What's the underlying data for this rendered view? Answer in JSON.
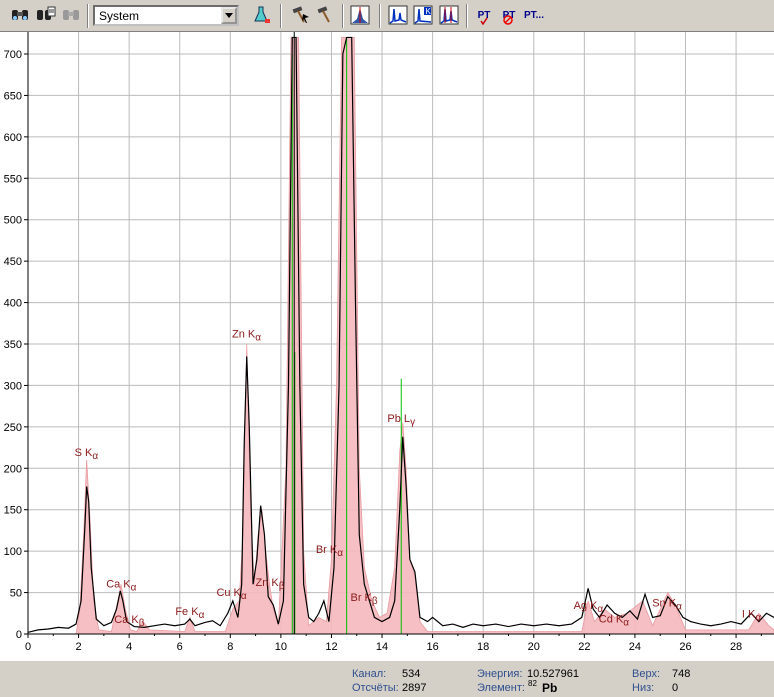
{
  "toolbar": {
    "profile_value": "System",
    "icons": [
      "binoculars-icon",
      "binoculars-doc-icon",
      "binoculars-disabled-icon",
      "flask-icon",
      "hammer-pointer-icon",
      "hammer-icon",
      "peak-icon",
      "spectrum-icon",
      "spectrum-k-icon",
      "spectrum-marked-icon",
      "pt-check-icon",
      "pt-no-icon",
      "pt-more-icon"
    ],
    "pt_label": "PT",
    "pt_more_label": "PT..."
  },
  "chart_data": {
    "type": "line",
    "xlim": [
      0,
      29.5
    ],
    "ylim": [
      0,
      700
    ],
    "x_ticks": [
      0,
      2,
      4,
      6,
      8,
      10,
      12,
      14,
      16,
      18,
      20,
      22,
      24,
      26,
      28
    ],
    "y_ticks": [
      0,
      50,
      100,
      150,
      200,
      250,
      300,
      350,
      400,
      450,
      500,
      550,
      600,
      650,
      700
    ],
    "grid": true,
    "line_color": "#000000",
    "fit_color": "#f4b8bc",
    "marker_color": "#00c000",
    "cursor_energy": 10.527961,
    "series": [
      {
        "values": [
          [
            0,
            2
          ],
          [
            0.4,
            5
          ],
          [
            0.8,
            6
          ],
          [
            1.2,
            8
          ],
          [
            1.6,
            7
          ],
          [
            1.9,
            12
          ],
          [
            2.1,
            40
          ],
          [
            2.25,
            130
          ],
          [
            2.32,
            178
          ],
          [
            2.4,
            160
          ],
          [
            2.5,
            80
          ],
          [
            2.7,
            18
          ],
          [
            3.0,
            10
          ],
          [
            3.3,
            14
          ],
          [
            3.5,
            30
          ],
          [
            3.65,
            52
          ],
          [
            3.75,
            40
          ],
          [
            3.9,
            15
          ],
          [
            4.2,
            9
          ],
          [
            4.6,
            8
          ],
          [
            5.0,
            10
          ],
          [
            5.4,
            12
          ],
          [
            5.8,
            10
          ],
          [
            6.2,
            12
          ],
          [
            6.4,
            18
          ],
          [
            6.6,
            10
          ],
          [
            7.0,
            14
          ],
          [
            7.3,
            16
          ],
          [
            7.6,
            10
          ],
          [
            7.9,
            25
          ],
          [
            8.1,
            40
          ],
          [
            8.3,
            20
          ],
          [
            8.45,
            60
          ],
          [
            8.55,
            230
          ],
          [
            8.65,
            335
          ],
          [
            8.75,
            250
          ],
          [
            8.9,
            60
          ],
          [
            9.05,
            90
          ],
          [
            9.2,
            155
          ],
          [
            9.35,
            120
          ],
          [
            9.5,
            45
          ],
          [
            9.7,
            35
          ],
          [
            9.9,
            12
          ],
          [
            10.1,
            40
          ],
          [
            10.3,
            300
          ],
          [
            10.45,
            720
          ],
          [
            10.6,
            720
          ],
          [
            10.75,
            300
          ],
          [
            10.9,
            60
          ],
          [
            11.1,
            20
          ],
          [
            11.3,
            15
          ],
          [
            11.5,
            25
          ],
          [
            11.7,
            40
          ],
          [
            11.9,
            15
          ],
          [
            12.1,
            80
          ],
          [
            12.3,
            300
          ],
          [
            12.45,
            700
          ],
          [
            12.6,
            720
          ],
          [
            12.8,
            720
          ],
          [
            12.95,
            400
          ],
          [
            13.1,
            120
          ],
          [
            13.3,
            60
          ],
          [
            13.5,
            40
          ],
          [
            13.7,
            20
          ],
          [
            14.0,
            15
          ],
          [
            14.3,
            20
          ],
          [
            14.5,
            40
          ],
          [
            14.7,
            150
          ],
          [
            14.82,
            238
          ],
          [
            14.95,
            180
          ],
          [
            15.1,
            90
          ],
          [
            15.3,
            75
          ],
          [
            15.5,
            20
          ],
          [
            15.8,
            15
          ],
          [
            16.0,
            20
          ],
          [
            16.4,
            10
          ],
          [
            16.8,
            12
          ],
          [
            17.2,
            8
          ],
          [
            17.6,
            12
          ],
          [
            18.0,
            10
          ],
          [
            18.5,
            12
          ],
          [
            19.0,
            9
          ],
          [
            19.5,
            12
          ],
          [
            20.0,
            10
          ],
          [
            20.5,
            12
          ],
          [
            21.0,
            10
          ],
          [
            21.5,
            12
          ],
          [
            21.9,
            20
          ],
          [
            22.15,
            55
          ],
          [
            22.35,
            30
          ],
          [
            22.6,
            20
          ],
          [
            22.9,
            35
          ],
          [
            23.2,
            25
          ],
          [
            23.5,
            20
          ],
          [
            23.8,
            28
          ],
          [
            24.1,
            18
          ],
          [
            24.4,
            48
          ],
          [
            24.7,
            20
          ],
          [
            25.0,
            22
          ],
          [
            25.3,
            45
          ],
          [
            25.6,
            35
          ],
          [
            25.9,
            20
          ],
          [
            26.2,
            15
          ],
          [
            26.6,
            12
          ],
          [
            27.0,
            10
          ],
          [
            27.4,
            12
          ],
          [
            27.8,
            15
          ],
          [
            28.2,
            12
          ],
          [
            28.6,
            25
          ],
          [
            28.9,
            15
          ],
          [
            29.2,
            25
          ],
          [
            29.5,
            20
          ]
        ]
      }
    ],
    "fit": [
      [
        0,
        0
      ],
      [
        1.9,
        0
      ],
      [
        2.05,
        30
      ],
      [
        2.2,
        120
      ],
      [
        2.32,
        210
      ],
      [
        2.45,
        140
      ],
      [
        2.6,
        40
      ],
      [
        2.8,
        5
      ],
      [
        3.3,
        3
      ],
      [
        3.55,
        40
      ],
      [
        3.68,
        60
      ],
      [
        3.85,
        30
      ],
      [
        4.05,
        5
      ],
      [
        4.3,
        3
      ],
      [
        4.55,
        15
      ],
      [
        4.8,
        5
      ],
      [
        6.2,
        3
      ],
      [
        6.4,
        20
      ],
      [
        6.6,
        3
      ],
      [
        7.8,
        3
      ],
      [
        8.1,
        30
      ],
      [
        8.35,
        40
      ],
      [
        8.5,
        120
      ],
      [
        8.65,
        350
      ],
      [
        8.8,
        150
      ],
      [
        8.95,
        60
      ],
      [
        9.1,
        120
      ],
      [
        9.25,
        150
      ],
      [
        9.4,
        100
      ],
      [
        9.55,
        60
      ],
      [
        9.7,
        30
      ],
      [
        9.9,
        10
      ],
      [
        10.2,
        200
      ],
      [
        10.4,
        720
      ],
      [
        10.7,
        720
      ],
      [
        10.9,
        100
      ],
      [
        11.1,
        10
      ],
      [
        11.5,
        20
      ],
      [
        11.8,
        15
      ],
      [
        12.0,
        90
      ],
      [
        12.2,
        300
      ],
      [
        12.4,
        720
      ],
      [
        12.9,
        720
      ],
      [
        13.1,
        200
      ],
      [
        13.3,
        80
      ],
      [
        13.6,
        40
      ],
      [
        13.9,
        20
      ],
      [
        14.2,
        25
      ],
      [
        14.5,
        80
      ],
      [
        14.7,
        220
      ],
      [
        14.82,
        255
      ],
      [
        14.95,
        200
      ],
      [
        15.1,
        90
      ],
      [
        15.3,
        70
      ],
      [
        15.5,
        15
      ],
      [
        15.8,
        3
      ],
      [
        21.9,
        3
      ],
      [
        22.15,
        40
      ],
      [
        22.4,
        15
      ],
      [
        22.8,
        30
      ],
      [
        23.2,
        20
      ],
      [
        23.7,
        25
      ],
      [
        24.3,
        40
      ],
      [
        24.7,
        10
      ],
      [
        25.3,
        50
      ],
      [
        25.6,
        35
      ],
      [
        26.0,
        5
      ],
      [
        28.5,
        5
      ],
      [
        28.9,
        25
      ],
      [
        29.3,
        10
      ],
      [
        29.5,
        5
      ]
    ],
    "markers": [
      10.45,
      10.55,
      12.6,
      14.76
    ],
    "element_lines": [
      {
        "x": 10.45,
        "y": 700
      },
      {
        "x": 10.55,
        "y": 340
      },
      {
        "x": 12.6,
        "y": 720
      },
      {
        "x": 14.76,
        "y": 308
      }
    ],
    "annotations": [
      {
        "text": "S K",
        "sub": "α",
        "x": 2.31,
        "y": 215
      },
      {
        "text": "Ca K",
        "sub": "α",
        "x": 3.69,
        "y": 56
      },
      {
        "text": "Ca K",
        "sub": "β",
        "x": 4.01,
        "y": 13
      },
      {
        "text": "Fe K",
        "sub": "α",
        "x": 6.4,
        "y": 23
      },
      {
        "text": "Cu K",
        "sub": "α",
        "x": 8.05,
        "y": 46
      },
      {
        "text": "Zn K",
        "sub": "α",
        "x": 8.64,
        "y": 358
      },
      {
        "text": "Zn K",
        "sub": "β",
        "x": 9.57,
        "y": 58
      },
      {
        "text": "Br K",
        "sub": "α",
        "x": 11.92,
        "y": 98
      },
      {
        "text": "Br K",
        "sub": "β",
        "x": 13.29,
        "y": 40
      },
      {
        "text": "Pb L",
        "sub": "γ",
        "x": 14.76,
        "y": 256
      },
      {
        "text": "Ag K",
        "sub": "α",
        "x": 22.16,
        "y": 30
      },
      {
        "text": "Cd K",
        "sub": "α",
        "x": 23.17,
        "y": 14
      },
      {
        "text": "Sn K",
        "sub": "α",
        "x": 25.27,
        "y": 33
      },
      {
        "text": "I K",
        "sub": "α",
        "x": 28.61,
        "y": 20
      }
    ]
  },
  "status": {
    "channel_label": "Канал:",
    "channel_value": "534",
    "counts_label": "Отсчёты:",
    "counts_value": "2897",
    "energy_label": "Энергия:",
    "energy_value": "10.527961",
    "element_label": "Элемент:",
    "element_number": "82",
    "element_symbol": "Pb",
    "top_label": "Верх:",
    "top_value": "748",
    "bottom_label": "Низ:",
    "bottom_value": "0"
  }
}
